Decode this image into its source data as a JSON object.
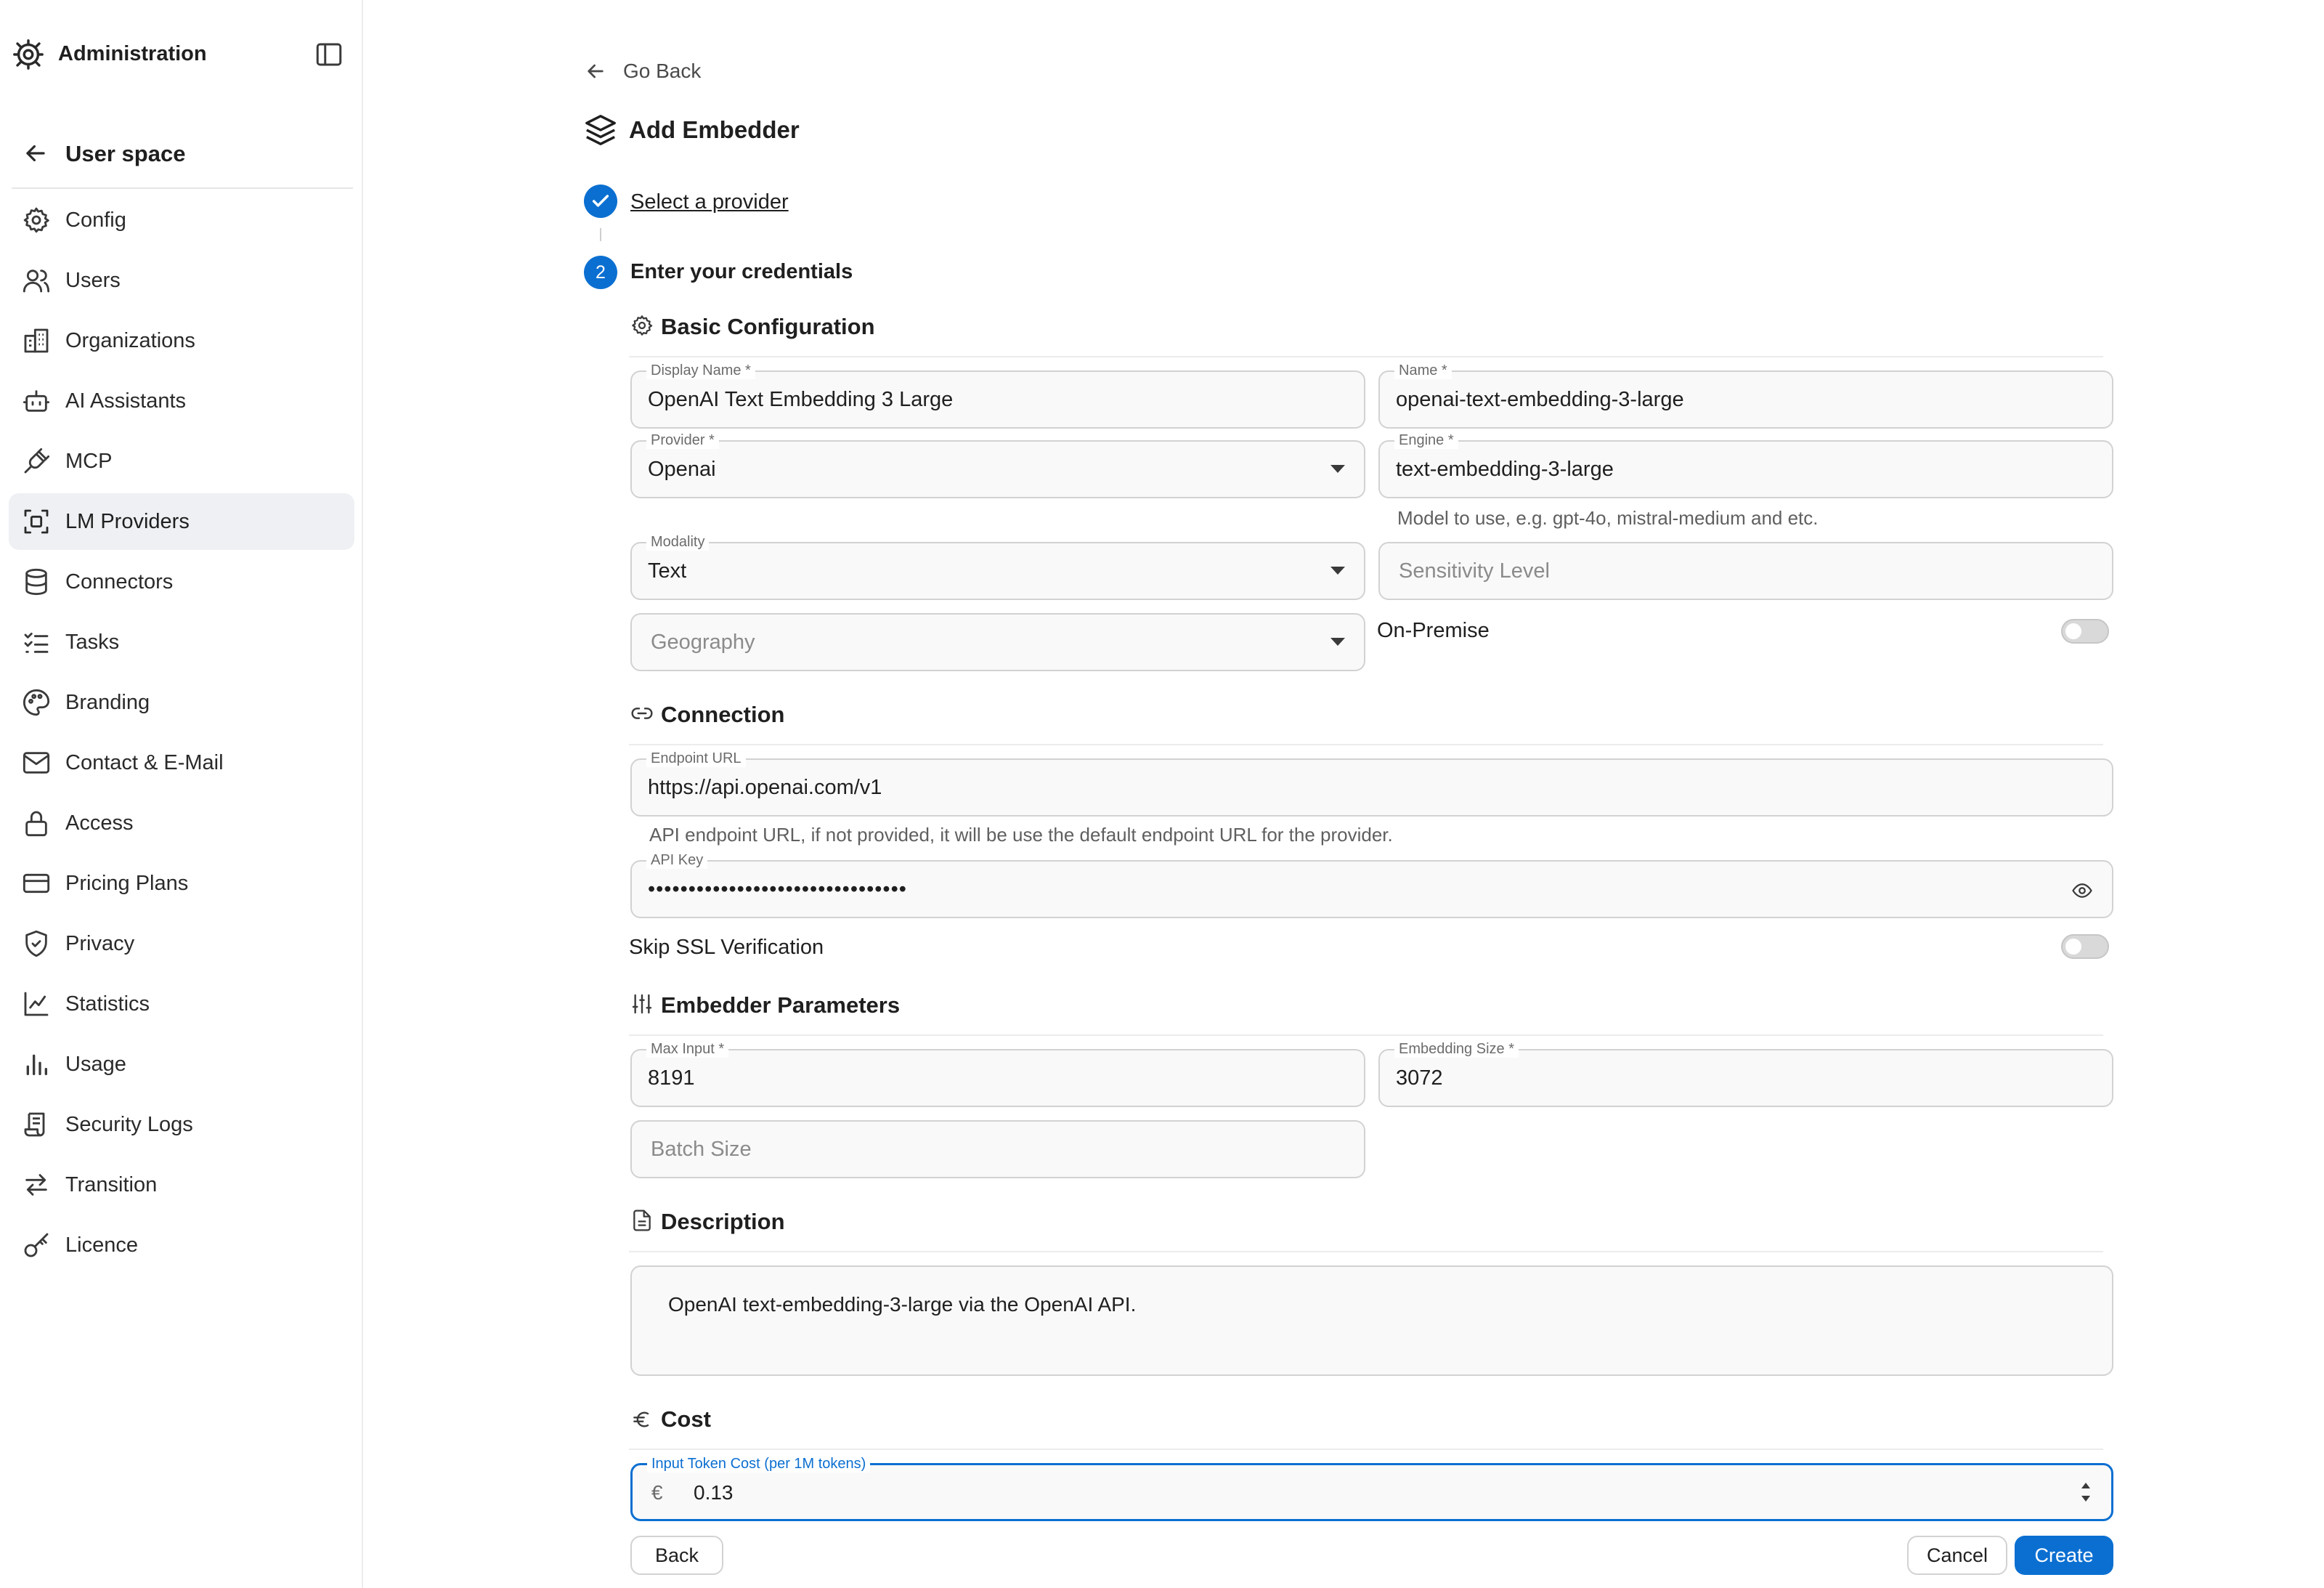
{
  "sidebar": {
    "title": "Administration",
    "back_label": "User space",
    "items": [
      {
        "label": "Config",
        "icon": "gear-icon"
      },
      {
        "label": "Users",
        "icon": "users-icon"
      },
      {
        "label": "Organizations",
        "icon": "building-icon"
      },
      {
        "label": "AI Assistants",
        "icon": "robot-icon"
      },
      {
        "label": "MCP",
        "icon": "plug-icon"
      },
      {
        "label": "LM Providers",
        "icon": "scan-icon",
        "active": true
      },
      {
        "label": "Connectors",
        "icon": "database-icon"
      },
      {
        "label": "Tasks",
        "icon": "list-checks-icon"
      },
      {
        "label": "Branding",
        "icon": "palette-icon"
      },
      {
        "label": "Contact & E-Mail",
        "icon": "mail-icon"
      },
      {
        "label": "Access",
        "icon": "lock-icon"
      },
      {
        "label": "Pricing Plans",
        "icon": "credit-card-icon"
      },
      {
        "label": "Privacy",
        "icon": "shield-icon"
      },
      {
        "label": "Statistics",
        "icon": "line-chart-icon"
      },
      {
        "label": "Usage",
        "icon": "bar-chart-icon"
      },
      {
        "label": "Security Logs",
        "icon": "scroll-icon"
      },
      {
        "label": "Transition",
        "icon": "arrows-icon"
      },
      {
        "label": "Licence",
        "icon": "key-icon"
      }
    ]
  },
  "main": {
    "go_back": "Go Back",
    "page_title": "Add Embedder",
    "steps": [
      {
        "number": "1",
        "label": "Select a provider",
        "done": true
      },
      {
        "number": "2",
        "label": "Enter your credentials",
        "done": false
      }
    ],
    "sections": {
      "basic": "Basic Configuration",
      "connection": "Connection",
      "params": "Embedder Parameters",
      "description": "Description",
      "cost": "Cost"
    },
    "fields": {
      "display_name": {
        "label": "Display Name *",
        "value": "OpenAI Text Embedding 3 Large"
      },
      "name": {
        "label": "Name *",
        "value": "openai-text-embedding-3-large"
      },
      "provider": {
        "label": "Provider *",
        "value": "Openai"
      },
      "engine": {
        "label": "Engine *",
        "value": "text-embedding-3-large",
        "helper": "Model to use, e.g. gpt-4o, mistral-medium and etc."
      },
      "modality": {
        "label": "Modality",
        "value": "Text"
      },
      "sensitivity": {
        "placeholder": "Sensitivity Level"
      },
      "geography": {
        "placeholder": "Geography"
      },
      "on_premise": {
        "label": "On-Premise",
        "checked": false
      },
      "endpoint": {
        "label": "Endpoint URL",
        "value": "https://api.openai.com/v1",
        "helper": "API endpoint URL, if not provided, it will be use the default endpoint URL for the provider."
      },
      "api_key": {
        "label": "API Key",
        "value": "••••••••••••••••••••••••••••••••"
      },
      "skip_ssl": {
        "label": "Skip SSL Verification",
        "checked": false
      },
      "max_input": {
        "label": "Max Input *",
        "value": "8191"
      },
      "embedding_size": {
        "label": "Embedding Size *",
        "value": "3072"
      },
      "batch_size": {
        "placeholder": "Batch Size"
      },
      "description": {
        "value": "OpenAI text-embedding-3-large via the OpenAI API."
      },
      "input_cost": {
        "label": "Input Token Cost (per 1M tokens)",
        "currency": "€",
        "value": "0.13"
      }
    },
    "buttons": {
      "back": "Back",
      "cancel": "Cancel",
      "create": "Create"
    }
  },
  "colors": {
    "accent": "#0b6fd1",
    "active_nav": "#eef0f3",
    "border": "#d2d2d2"
  }
}
